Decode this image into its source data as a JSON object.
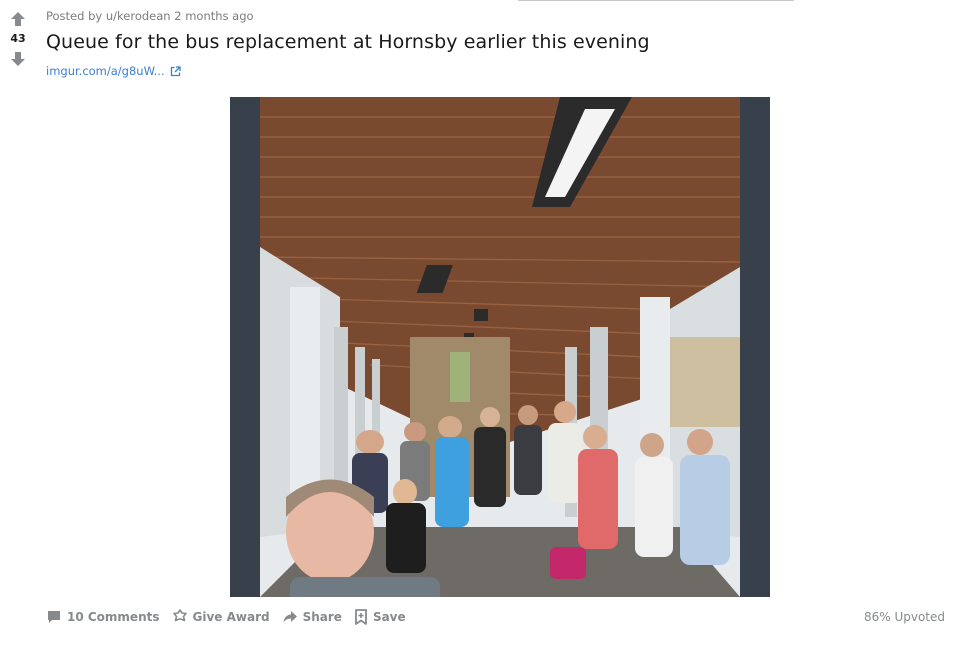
{
  "post": {
    "score": "43",
    "posted_by_prefix": "Posted by",
    "author": "u/kerodean",
    "age": "2 months ago",
    "title": "Queue for the bus replacement at Hornsby earlier this evening",
    "link_text": "imgur.com/a/g8uW...",
    "upvote_ratio": "86% Upvoted"
  },
  "actions": {
    "comments": "10 Comments",
    "award": "Give Award",
    "share": "Share",
    "save": "Save"
  },
  "icons": {
    "upvote": "arrow-up-icon",
    "downvote": "arrow-down-icon",
    "external": "external-link-icon",
    "comments": "comment-bubble-icon",
    "award": "award-badge-icon",
    "share": "share-arrow-icon",
    "save": "bookmark-icon"
  },
  "colors": {
    "link": "#3a7fd5",
    "muted": "#878a8c",
    "title": "#1a1a1b",
    "media_bg": "#38414b"
  }
}
